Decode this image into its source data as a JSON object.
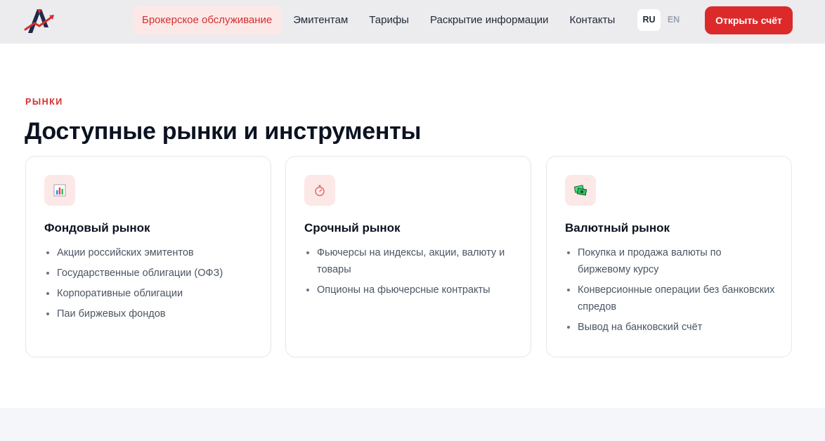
{
  "header": {
    "logo_icon": "brand-a-logo-icon",
    "nav": [
      {
        "label": "Брокерское обслуживание",
        "active": true
      },
      {
        "label": "Эмитентам",
        "active": false
      },
      {
        "label": "Тарифы",
        "active": false
      },
      {
        "label": "Раскрытие информации",
        "active": false
      },
      {
        "label": "Контакты",
        "active": false
      }
    ],
    "lang": {
      "ru": "RU",
      "en": "EN",
      "selected": "RU"
    },
    "cta_label": "Открыть счёт"
  },
  "section": {
    "eyebrow": "РЫНКИ",
    "title": "Доступные рынки и инструменты"
  },
  "cards": [
    {
      "icon": "bar-chart-icon",
      "title": "Фондовый рынок",
      "items": [
        "Акции российских эмитентов",
        "Государственные облигации (ОФЗ)",
        "Корпоративные облигации",
        "Паи биржевых фондов"
      ]
    },
    {
      "icon": "stopwatch-icon",
      "title": "Срочный рынок",
      "items": [
        "Фьючерсы на индексы, акции, валюту и товары",
        "Опционы на фьючерсные контракты"
      ]
    },
    {
      "icon": "currency-exchange-icon",
      "title": "Валютный рынок",
      "items": [
        "Покупка и продажа валюты по биржевому курсу",
        "Конверсионные операции без банковских спредов",
        "Вывод на банковский счёт"
      ]
    }
  ],
  "colors": {
    "accent": "#dc2a2a",
    "accent_soft": "#fde8e8",
    "header_bg": "#ececee",
    "text_dark": "#0b1220",
    "text_muted": "#4b5563"
  }
}
